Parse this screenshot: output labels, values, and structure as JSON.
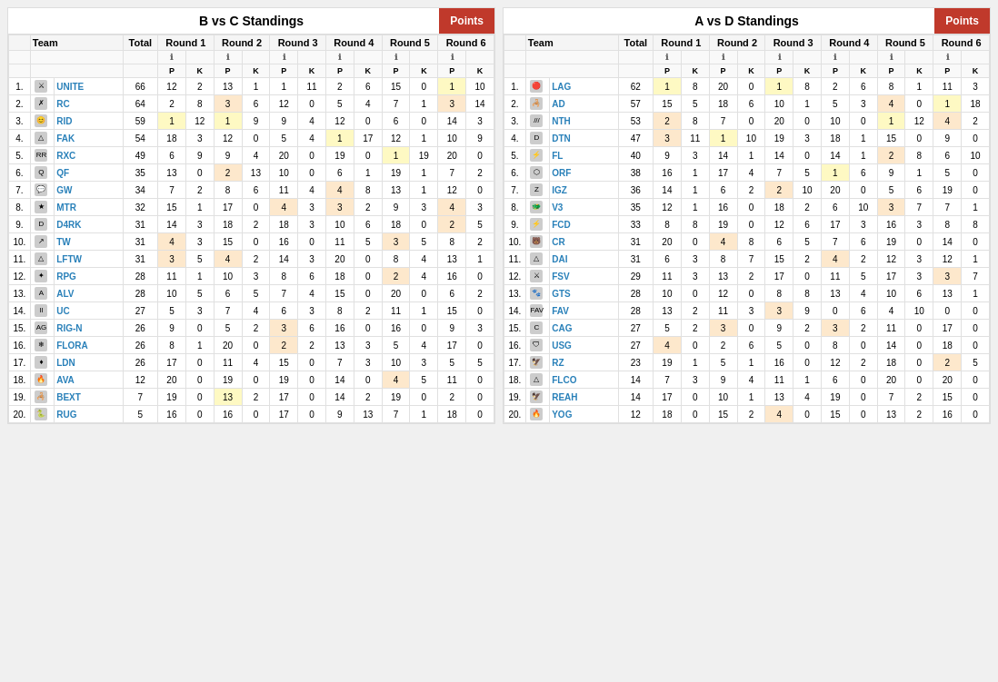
{
  "left": {
    "title": "B vs C Standings",
    "points_btn": "Points",
    "teams": [
      {
        "rank": 1,
        "logo": "⚔",
        "name": "UNITE",
        "total": 66,
        "r1p": 12,
        "r1k": 2,
        "r2p": 13,
        "r2k": 1,
        "r3p": 1,
        "r3k": 11,
        "r4p": 2,
        "r4k": 6,
        "r5p": 15,
        "r5k": 0,
        "r6p": 1,
        "r6k": 10,
        "r3_hl": "yellow",
        "r6p_hl": "yellow"
      },
      {
        "rank": 2,
        "logo": "✗",
        "name": "RC",
        "total": 64,
        "r1p": 2,
        "r1k": 8,
        "r2p": 3,
        "r2k": 6,
        "r3p": 12,
        "r3k": 0,
        "r4p": 5,
        "r4k": 4,
        "r5p": 7,
        "r5k": 1,
        "r6p": 3,
        "r6k": 14,
        "r2p_hl": "orange",
        "r6p_hl": "orange"
      },
      {
        "rank": 3,
        "logo": "😊",
        "name": "RID",
        "total": 59,
        "r1p": 1,
        "r1k": 12,
        "r2p": 1,
        "r2k": 9,
        "r3p": 9,
        "r3k": 4,
        "r4p": 12,
        "r4k": 0,
        "r5p": 6,
        "r5k": 0,
        "r6p": 14,
        "r6k": 3,
        "r1p_hl": "yellow",
        "r2p_hl": "yellow"
      },
      {
        "rank": 4,
        "logo": "△",
        "name": "FAK",
        "total": 54,
        "r1p": 18,
        "r1k": 3,
        "r2p": 12,
        "r2k": 0,
        "r3p": 5,
        "r3k": 4,
        "r4p": 1,
        "r4k": 17,
        "r5p": 12,
        "r5k": 1,
        "r6p": 10,
        "r6k": 9,
        "r4p_hl": "yellow"
      },
      {
        "rank": 5,
        "logo": "RR",
        "name": "RXC",
        "total": 49,
        "r1p": 6,
        "r1k": 9,
        "r2p": 9,
        "r2k": 4,
        "r3p": 20,
        "r3k": 0,
        "r4p": 19,
        "r4k": 0,
        "r5p": 1,
        "r5k": 19,
        "r6p": 20,
        "r6k": 0,
        "r5p_hl": "yellow"
      },
      {
        "rank": 6,
        "logo": "Q",
        "name": "QF",
        "total": 35,
        "r1p": 13,
        "r1k": 0,
        "r2p": 2,
        "r2k": 13,
        "r3p": 10,
        "r3k": 0,
        "r4p": 6,
        "r4k": 1,
        "r5p": 19,
        "r5k": 1,
        "r6p": 7,
        "r6k": 2,
        "r2p_hl": "orange"
      },
      {
        "rank": 7,
        "logo": "💬",
        "name": "GW",
        "total": 34,
        "r1p": 7,
        "r1k": 2,
        "r2p": 8,
        "r2k": 6,
        "r3p": 11,
        "r3k": 4,
        "r4p": 4,
        "r4k": 8,
        "r5p": 13,
        "r5k": 1,
        "r6p": 12,
        "r6k": 0,
        "r4p_hl": "orange"
      },
      {
        "rank": 8,
        "logo": "★",
        "name": "MTR",
        "total": 32,
        "r1p": 15,
        "r1k": 1,
        "r2p": 17,
        "r2k": 0,
        "r3p": 4,
        "r3k": 3,
        "r4p": 3,
        "r4k": 2,
        "r5p": 9,
        "r5k": 3,
        "r6p": 4,
        "r6k": 3,
        "r3p_hl": "orange",
        "r4p_hl": "orange",
        "r6p_hl": "orange"
      },
      {
        "rank": 9,
        "logo": "D",
        "name": "D4RK",
        "total": 31,
        "r1p": 14,
        "r1k": 3,
        "r2p": 18,
        "r2k": 2,
        "r3p": 18,
        "r3k": 3,
        "r4p": 10,
        "r4k": 6,
        "r5p": 18,
        "r5k": 0,
        "r6p": 2,
        "r6k": 5,
        "r6p_hl": "orange"
      },
      {
        "rank": 10,
        "logo": "↗",
        "name": "TW",
        "total": 31,
        "r1p": 4,
        "r1k": 3,
        "r2p": 15,
        "r2k": 0,
        "r3p": 16,
        "r3k": 0,
        "r4p": 11,
        "r4k": 5,
        "r5p": 3,
        "r5k": 5,
        "r6p": 8,
        "r6k": 2,
        "r1p_hl": "orange",
        "r5p_hl": "orange"
      },
      {
        "rank": 11,
        "logo": "△",
        "name": "LFTW",
        "total": 31,
        "r1p": 3,
        "r1k": 5,
        "r2p": 4,
        "r2k": 2,
        "r3p": 14,
        "r3k": 3,
        "r4p": 20,
        "r4k": 0,
        "r5p": 8,
        "r5k": 4,
        "r6p": 13,
        "r6k": 1,
        "r1p_hl": "orange",
        "r2p_hl": "orange"
      },
      {
        "rank": 12,
        "logo": "✦",
        "name": "RPG",
        "total": 28,
        "r1p": 11,
        "r1k": 1,
        "r2p": 10,
        "r2k": 3,
        "r3p": 8,
        "r3k": 6,
        "r4p": 18,
        "r4k": 0,
        "r5p": 2,
        "r5k": 4,
        "r6p": 16,
        "r6k": 0,
        "r5p_hl": "orange"
      },
      {
        "rank": 13,
        "logo": "A",
        "name": "ALV",
        "total": 28,
        "r1p": 10,
        "r1k": 5,
        "r2p": 6,
        "r2k": 5,
        "r3p": 7,
        "r3k": 4,
        "r4p": 15,
        "r4k": 0,
        "r5p": 20,
        "r5k": 0,
        "r6p": 6,
        "r6k": 2
      },
      {
        "rank": 14,
        "logo": "ll",
        "name": "UC",
        "total": 27,
        "r1p": 5,
        "r1k": 3,
        "r2p": 7,
        "r2k": 4,
        "r3p": 6,
        "r3k": 3,
        "r4p": 8,
        "r4k": 2,
        "r5p": 11,
        "r5k": 1,
        "r6p": 15,
        "r6k": 0
      },
      {
        "rank": 15,
        "logo": "AG",
        "name": "RIG-N",
        "total": 26,
        "r1p": 9,
        "r1k": 0,
        "r2p": 5,
        "r2k": 2,
        "r3p": 3,
        "r3k": 6,
        "r4p": 16,
        "r4k": 0,
        "r5p": 16,
        "r5k": 0,
        "r6p": 9,
        "r6k": 3,
        "r3p_hl": "orange"
      },
      {
        "rank": 16,
        "logo": "❄",
        "name": "FLORA",
        "total": 26,
        "r1p": 8,
        "r1k": 1,
        "r2p": 20,
        "r2k": 0,
        "r3p": 2,
        "r3k": 2,
        "r4p": 13,
        "r4k": 3,
        "r5p": 5,
        "r5k": 4,
        "r6p": 17,
        "r6k": 0,
        "r3p_hl": "orange"
      },
      {
        "rank": 17,
        "logo": "♦",
        "name": "LDN",
        "total": 26,
        "r1p": 17,
        "r1k": 0,
        "r2p": 11,
        "r2k": 4,
        "r3p": 15,
        "r3k": 0,
        "r4p": 7,
        "r4k": 3,
        "r5p": 10,
        "r5k": 3,
        "r6p": 5,
        "r6k": 5
      },
      {
        "rank": 18,
        "logo": "🔥",
        "name": "AVA",
        "total": 12,
        "r1p": 20,
        "r1k": 0,
        "r2p": 19,
        "r2k": 0,
        "r3p": 19,
        "r3k": 0,
        "r4p": 14,
        "r4k": 0,
        "r5p": 4,
        "r5k": 5,
        "r6p": 11,
        "r6k": 0,
        "r5p_hl": "orange"
      },
      {
        "rank": 19,
        "logo": "🦂",
        "name": "BEXT",
        "total": 7,
        "r1p": 19,
        "r1k": 0,
        "r2p": 13,
        "r2k": 2,
        "r3p": 17,
        "r3k": 0,
        "r4p": 14,
        "r4k": 2,
        "r5p": 19,
        "r5k": 0,
        "r6p": 2,
        "r6k": 0,
        "r2p_hl": "yellow"
      },
      {
        "rank": 20,
        "logo": "🐍",
        "name": "RUG",
        "total": 5,
        "r1p": 16,
        "r1k": 0,
        "r2p": 16,
        "r2k": 0,
        "r3p": 17,
        "r3k": 0,
        "r4p": 9,
        "r4k": 13,
        "r5p": 7,
        "r5k": 1,
        "r6p": 18,
        "r6k": 0
      }
    ]
  },
  "right": {
    "title": "A vs D Standings",
    "points_btn": "Points",
    "teams": [
      {
        "rank": 1,
        "logo": "🔴",
        "name": "LAG",
        "total": 62,
        "r1p": 1,
        "r1k": 8,
        "r2p": 20,
        "r2k": 0,
        "r3p": 1,
        "r3k": 8,
        "r4p": 2,
        "r4k": 6,
        "r5p": 8,
        "r5k": 1,
        "r6p": 11,
        "r6k": 3,
        "r1p_hl": "yellow",
        "r3p_hl": "yellow"
      },
      {
        "rank": 2,
        "logo": "🦂",
        "name": "AD",
        "total": 57,
        "r1p": 15,
        "r1k": 5,
        "r2p": 18,
        "r2k": 6,
        "r3p": 10,
        "r3k": 1,
        "r4p": 5,
        "r4k": 3,
        "r5p": 4,
        "r5k": 0,
        "r6p": 1,
        "r6k": 18,
        "r5p_hl": "orange",
        "r6p_hl": "yellow"
      },
      {
        "rank": 3,
        "logo": "///",
        "name": "NTH",
        "total": 53,
        "r1p": 2,
        "r1k": 8,
        "r2p": 7,
        "r2k": 0,
        "r3p": 20,
        "r3k": 0,
        "r4p": 10,
        "r4k": 0,
        "r5p": 1,
        "r5k": 12,
        "r6p": 4,
        "r6k": 2,
        "r1p_hl": "orange",
        "r5p_hl": "yellow",
        "r6p_hl": "orange"
      },
      {
        "rank": 4,
        "logo": "D",
        "name": "DTN",
        "total": 47,
        "r1p": 3,
        "r1k": 11,
        "r2p": 1,
        "r2k": 10,
        "r3p": 19,
        "r3k": 3,
        "r4p": 18,
        "r4k": 1,
        "r5p": 15,
        "r5k": 0,
        "r6p": 9,
        "r6k": 0,
        "r1p_hl": "orange",
        "r2p_hl": "yellow"
      },
      {
        "rank": 5,
        "logo": "⚡",
        "name": "FL",
        "total": 40,
        "r1p": 9,
        "r1k": 3,
        "r2p": 14,
        "r2k": 1,
        "r3p": 14,
        "r3k": 0,
        "r4p": 14,
        "r4k": 1,
        "r5p": 2,
        "r5k": 8,
        "r6p": 6,
        "r6k": 10,
        "r5p_hl": "orange"
      },
      {
        "rank": 6,
        "logo": "⬡",
        "name": "ORF",
        "total": 38,
        "r1p": 16,
        "r1k": 1,
        "r2p": 17,
        "r2k": 4,
        "r3p": 7,
        "r3k": 5,
        "r4p": 1,
        "r4k": 6,
        "r5p": 9,
        "r5k": 1,
        "r6p": 5,
        "r6k": 0,
        "r4p_hl": "yellow"
      },
      {
        "rank": 7,
        "logo": "Z",
        "name": "IGZ",
        "total": 36,
        "r1p": 14,
        "r1k": 1,
        "r2p": 6,
        "r2k": 2,
        "r3p": 2,
        "r3k": 10,
        "r4p": 20,
        "r4k": 0,
        "r5p": 5,
        "r5k": 6,
        "r6p": 19,
        "r6k": 0,
        "r3p_hl": "orange"
      },
      {
        "rank": 8,
        "logo": "🐲",
        "name": "V3",
        "total": 35,
        "r1p": 12,
        "r1k": 1,
        "r2p": 16,
        "r2k": 0,
        "r3p": 18,
        "r3k": 2,
        "r4p": 6,
        "r4k": 10,
        "r5p": 3,
        "r5k": 7,
        "r6p": 7,
        "r6k": 1,
        "r5p_hl": "orange"
      },
      {
        "rank": 9,
        "logo": "⚡",
        "name": "FCD",
        "total": 33,
        "r1p": 8,
        "r1k": 8,
        "r2p": 19,
        "r2k": 0,
        "r3p": 12,
        "r3k": 6,
        "r4p": 17,
        "r4k": 3,
        "r5p": 16,
        "r5k": 3,
        "r6p": 8,
        "r6k": 8
      },
      {
        "rank": 10,
        "logo": "🐻",
        "name": "CR",
        "total": 31,
        "r1p": 20,
        "r1k": 0,
        "r2p": 4,
        "r2k": 8,
        "r3p": 6,
        "r3k": 5,
        "r4p": 7,
        "r4k": 6,
        "r5p": 19,
        "r5k": 0,
        "r6p": 14,
        "r6k": 0,
        "r2p_hl": "orange"
      },
      {
        "rank": 11,
        "logo": "△",
        "name": "DAI",
        "total": 31,
        "r1p": 6,
        "r1k": 3,
        "r2p": 8,
        "r2k": 7,
        "r3p": 15,
        "r3k": 2,
        "r4p": 4,
        "r4k": 2,
        "r5p": 12,
        "r5k": 3,
        "r6p": 12,
        "r6k": 1,
        "r4p_hl": "orange"
      },
      {
        "rank": 12,
        "logo": "⚔",
        "name": "FSV",
        "total": 29,
        "r1p": 11,
        "r1k": 3,
        "r2p": 13,
        "r2k": 2,
        "r3p": 17,
        "r3k": 0,
        "r4p": 11,
        "r4k": 5,
        "r5p": 17,
        "r5k": 3,
        "r6p": 3,
        "r6k": 7,
        "r6p_hl": "orange"
      },
      {
        "rank": 13,
        "logo": "🐾",
        "name": "GTS",
        "total": 28,
        "r1p": 10,
        "r1k": 0,
        "r2p": 12,
        "r2k": 0,
        "r3p": 8,
        "r3k": 8,
        "r4p": 13,
        "r4k": 4,
        "r5p": 10,
        "r5k": 6,
        "r6p": 13,
        "r6k": 1
      },
      {
        "rank": 14,
        "logo": "FAV",
        "name": "FAV",
        "total": 28,
        "r1p": 13,
        "r1k": 2,
        "r2p": 11,
        "r2k": 3,
        "r3p": 3,
        "r3k": 9,
        "r4p": 0,
        "r4k": 6,
        "r5p": 4,
        "r5k": 10,
        "r6p": 0,
        "r6k": 0,
        "r3p_hl": "orange"
      },
      {
        "rank": 15,
        "logo": "C",
        "name": "CAG",
        "total": 27,
        "r1p": 5,
        "r1k": 2,
        "r2p": 3,
        "r2k": 0,
        "r3p": 9,
        "r3k": 2,
        "r4p": 3,
        "r4k": 2,
        "r5p": 11,
        "r5k": 0,
        "r6p": 17,
        "r6k": 0,
        "r2p_hl": "orange",
        "r4p_hl": "orange"
      },
      {
        "rank": 16,
        "logo": "🛡",
        "name": "USG",
        "total": 27,
        "r1p": 4,
        "r1k": 0,
        "r2p": 2,
        "r2k": 6,
        "r3p": 5,
        "r3k": 0,
        "r4p": 8,
        "r4k": 0,
        "r5p": 14,
        "r5k": 0,
        "r6p": 18,
        "r6k": 0,
        "r1p_hl": "orange"
      },
      {
        "rank": 17,
        "logo": "🦅",
        "name": "RZ",
        "total": 23,
        "r1p": 19,
        "r1k": 1,
        "r2p": 5,
        "r2k": 1,
        "r3p": 16,
        "r3k": 0,
        "r4p": 12,
        "r4k": 2,
        "r5p": 18,
        "r5k": 0,
        "r6p": 2,
        "r6k": 5,
        "r6p_hl": "orange"
      },
      {
        "rank": 18,
        "logo": "△",
        "name": "FLCO",
        "total": 14,
        "r1p": 7,
        "r1k": 3,
        "r2p": 9,
        "r2k": 4,
        "r3p": 11,
        "r3k": 1,
        "r4p": 6,
        "r4k": 0,
        "r5p": 20,
        "r5k": 0,
        "r6p": 20,
        "r6k": 0
      },
      {
        "rank": 19,
        "logo": "🦅",
        "name": "REAH",
        "total": 14,
        "r1p": 17,
        "r1k": 0,
        "r2p": 10,
        "r2k": 1,
        "r3p": 13,
        "r3k": 4,
        "r4p": 19,
        "r4k": 0,
        "r5p": 7,
        "r5k": 2,
        "r6p": 15,
        "r6k": 0
      },
      {
        "rank": 20,
        "logo": "🔥",
        "name": "YOG",
        "total": 12,
        "r1p": 18,
        "r1k": 0,
        "r2p": 15,
        "r2k": 2,
        "r3p": 4,
        "r3k": 0,
        "r4p": 15,
        "r4k": 0,
        "r5p": 13,
        "r5k": 2,
        "r6p": 16,
        "r6k": 0,
        "r3p_hl": "orange"
      }
    ]
  },
  "headers": {
    "rank": "#",
    "team": "Team",
    "total": "Total",
    "round1": "Round 1",
    "round2": "Round 2",
    "round3": "Round 3",
    "round4": "Round 4",
    "round5": "Round 5",
    "round6": "Round 6",
    "p": "P",
    "k": "K"
  }
}
